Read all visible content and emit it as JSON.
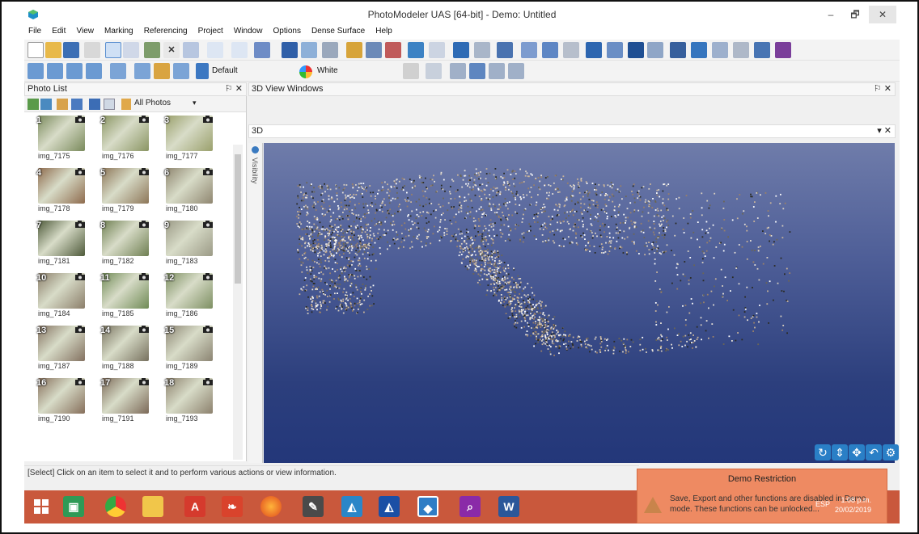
{
  "window": {
    "title": "PhotoModeler UAS [64-bit] - Demo: Untitled",
    "min_glyph": "–",
    "max_glyph": "🗗",
    "close_glyph": "✕"
  },
  "menu": [
    "File",
    "Edit",
    "View",
    "Marking",
    "Referencing",
    "Project",
    "Window",
    "Options",
    "Dense Surface",
    "Help"
  ],
  "toolbar2": {
    "style_combo": "Default",
    "color_combo": "White"
  },
  "photo_list": {
    "title": "Photo List",
    "pin_close": "⚐ ✕",
    "filter": "All Photos",
    "photos": [
      {
        "num": "1",
        "name": "img_7175",
        "tone": "#7a8a5c"
      },
      {
        "num": "2",
        "name": "img_7176",
        "tone": "#8a9563"
      },
      {
        "num": "3",
        "name": "img_7177",
        "tone": "#9aa06c"
      },
      {
        "num": "4",
        "name": "img_7178",
        "tone": "#8e6b4d"
      },
      {
        "num": "5",
        "name": "img_7179",
        "tone": "#8d7658"
      },
      {
        "num": "6",
        "name": "img_7180",
        "tone": "#8f8670"
      },
      {
        "num": "7",
        "name": "img_7181",
        "tone": "#4e5a3a"
      },
      {
        "num": "8",
        "name": "img_7182",
        "tone": "#6f7f52"
      },
      {
        "num": "9",
        "name": "img_7183",
        "tone": "#9b9a86"
      },
      {
        "num": "10",
        "name": "img_7184",
        "tone": "#8b7e6a"
      },
      {
        "num": "11",
        "name": "img_7185",
        "tone": "#6f8a55"
      },
      {
        "num": "12",
        "name": "img_7186",
        "tone": "#7d8f62"
      },
      {
        "num": "13",
        "name": "img_7187",
        "tone": "#837160"
      },
      {
        "num": "14",
        "name": "img_7188",
        "tone": "#77715e"
      },
      {
        "num": "15",
        "name": "img_7189",
        "tone": "#8b8472"
      },
      {
        "num": "16",
        "name": "img_7190",
        "tone": "#866f5b"
      },
      {
        "num": "17",
        "name": "img_7191",
        "tone": "#7c6a58"
      },
      {
        "num": "18",
        "name": "img_7193",
        "tone": "#8c816d"
      }
    ]
  },
  "view3d": {
    "title": "3D View Windows",
    "tab": "3D",
    "pin_close": "⚐ ✕",
    "tab_close": "▾ ✕",
    "visibility_label": "Visibility"
  },
  "status": "[Select] Click on an item to select it and to perform various actions or view information.",
  "popup": {
    "title": "Demo Restriction",
    "body": "Save, Export and other functions are disabled in Demo mode. These functions can be unlocked..."
  },
  "clock": {
    "time": "1:08 p.m.",
    "date": "20/02/2019",
    "lang": "ESP"
  },
  "colors": {
    "taskbar": "#c9583c",
    "popup": "#ee8a62",
    "view_top": "#6f7caa",
    "view_bottom": "#23377a"
  }
}
